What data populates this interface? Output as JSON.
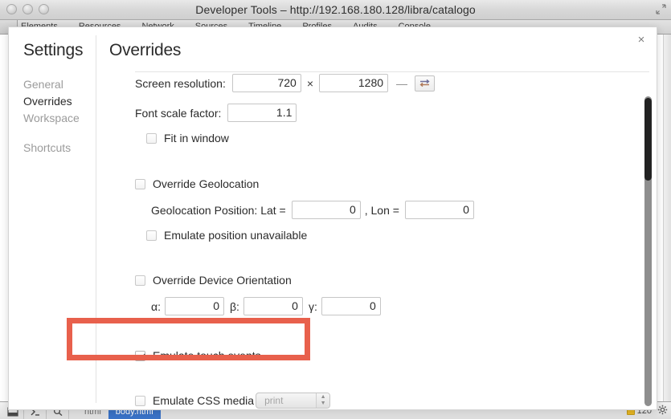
{
  "window": {
    "title": "Developer Tools – http://192.168.180.128/libra/catalogo",
    "traffic_lights": [
      "close-button",
      "minimize-button",
      "zoom-button"
    ],
    "resize_grip_icon": "resize-grip-icon"
  },
  "devtools": {
    "tabs": [
      "Elements",
      "Resources",
      "Network",
      "Sources",
      "Timeline",
      "Profiles",
      "Audits",
      "Console"
    ],
    "inspect_button_icon": "inspect-element-icon"
  },
  "statusbar": {
    "dock_icon": "dock-to-bottom-icon",
    "console_icon": "show-console-icon",
    "search_icon": "search-icon",
    "crumbs": [
      {
        "label": "html",
        "active": false
      },
      {
        "label": "body.html",
        "active": true
      }
    ],
    "warning_count": "120",
    "settings_icon": "gear-icon"
  },
  "settings": {
    "close_label": "×",
    "sidebar": {
      "title": "Settings",
      "items": [
        {
          "label": "General",
          "selected": false
        },
        {
          "label": "Overrides",
          "selected": true
        },
        {
          "label": "Workspace",
          "selected": false
        },
        {
          "label": "Shortcuts",
          "selected": false
        }
      ]
    },
    "content": {
      "title": "Overrides",
      "screen_resolution": {
        "label": "Screen resolution:",
        "width_value": "720",
        "times": "×",
        "height_value": "1280",
        "dash": "—",
        "swap_icon": "swap-dimensions-icon"
      },
      "font_scale": {
        "label": "Font scale factor:",
        "value": "1.1"
      },
      "fit_in_window": {
        "label": "Fit in window",
        "checked": false
      },
      "override_geolocation": {
        "label": "Override Geolocation",
        "checked": false
      },
      "geolocation_position": {
        "label": "Geolocation Position: Lat =",
        "lat_value": "0",
        "lon_label": ", Lon =",
        "lon_value": "0"
      },
      "emulate_position_unavailable": {
        "label": "Emulate position unavailable",
        "checked": false
      },
      "override_device_orientation": {
        "label": "Override Device Orientation",
        "checked": false
      },
      "orientation": {
        "alpha_label": "α:",
        "alpha_value": "0",
        "beta_label": "β:",
        "beta_value": "0",
        "gamma_label": "γ:",
        "gamma_value": "0"
      },
      "emulate_touch_events": {
        "label": "Emulate touch events",
        "checked": true,
        "highlight_color": "#e8604c"
      },
      "emulate_css_media": {
        "label": "Emulate CSS media",
        "checked": false,
        "selected_option": "print",
        "stepper_icon": "stepper-arrows-icon"
      }
    }
  }
}
